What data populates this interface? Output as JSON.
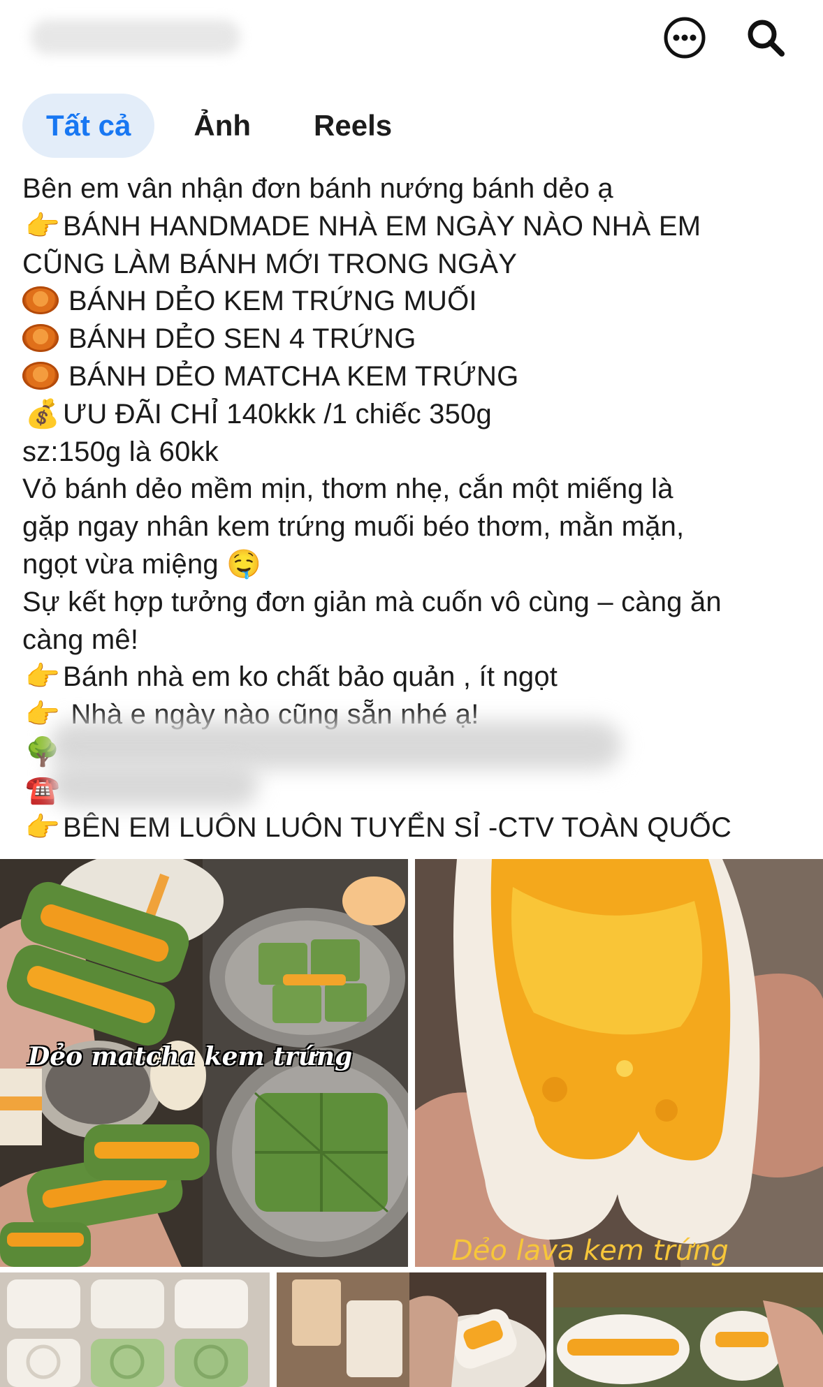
{
  "header": {
    "page_name_redacted": "Hương vị",
    "more_icon": "more-horizontal-icon",
    "search_icon": "search-icon"
  },
  "tabs": [
    {
      "label": "Tất cả",
      "active": true
    },
    {
      "label": "Ảnh",
      "active": false
    },
    {
      "label": "Reels",
      "active": false
    }
  ],
  "post": {
    "lines": [
      {
        "emoji": "",
        "text": "Bên em vân nhận đơn bánh nướng bánh dẻo ạ"
      },
      {
        "emoji": "👉",
        "text": "BÁNH HANDMADE NHÀ EM NGÀY NÀO NHÀ EM"
      },
      {
        "emoji": "",
        "text": "CŨNG LÀM BÁNH MỚI TRONG NGÀY"
      },
      {
        "emoji": "mooncake",
        "text": "BÁNH DẺO KEM TRỨNG MUỐI"
      },
      {
        "emoji": "mooncake",
        "text": "BÁNH DẺO SEN 4 TRỨNG"
      },
      {
        "emoji": "mooncake",
        "text": "BÁNH DẺO MATCHA KEM TRỨNG"
      },
      {
        "emoji": "💰",
        "text": "ƯU ĐÃI CHỈ  140kkk /1 chiếc 350g"
      },
      {
        "emoji": "",
        "text": "sz:150g là 60kk"
      },
      {
        "emoji": "",
        "text": "Vỏ bánh dẻo mềm mịn, thơm nhẹ, cắn một miếng là"
      },
      {
        "emoji": "",
        "text": "gặp ngay nhân kem trứng muối béo thơm, mằn mặn,"
      },
      {
        "emoji": "",
        "text": "ngọt vừa miệng 🤤"
      },
      {
        "emoji": "",
        "text": "Sự kết hợp tưởng đơn giản mà cuốn vô cùng – càng ăn"
      },
      {
        "emoji": "",
        "text": "càng mê!"
      },
      {
        "emoji": "👉",
        "text": "Bánh nhà em ko chất bảo quản , ít ngọt"
      },
      {
        "emoji": "👉",
        "text": " Nhà e ngày nào cũng sẵn nhé ạ!"
      },
      {
        "emoji": "🌳",
        "text": ""
      },
      {
        "emoji": "☎️",
        "text": ""
      },
      {
        "emoji": "👉",
        "text": "BÊN EM LUÔN LUÔN TUYỂN SỈ -CTV TOÀN QUỐC"
      }
    ]
  },
  "photos": {
    "photo1_caption": "Dẻo matcha kem trứng",
    "photo2_caption": "Dẻo lava kem trứng"
  },
  "colors": {
    "accent": "#1877f2",
    "active_tab_bg": "#e3edf9",
    "matcha": "#5e8f3a",
    "yolk": "#f4a81c"
  }
}
